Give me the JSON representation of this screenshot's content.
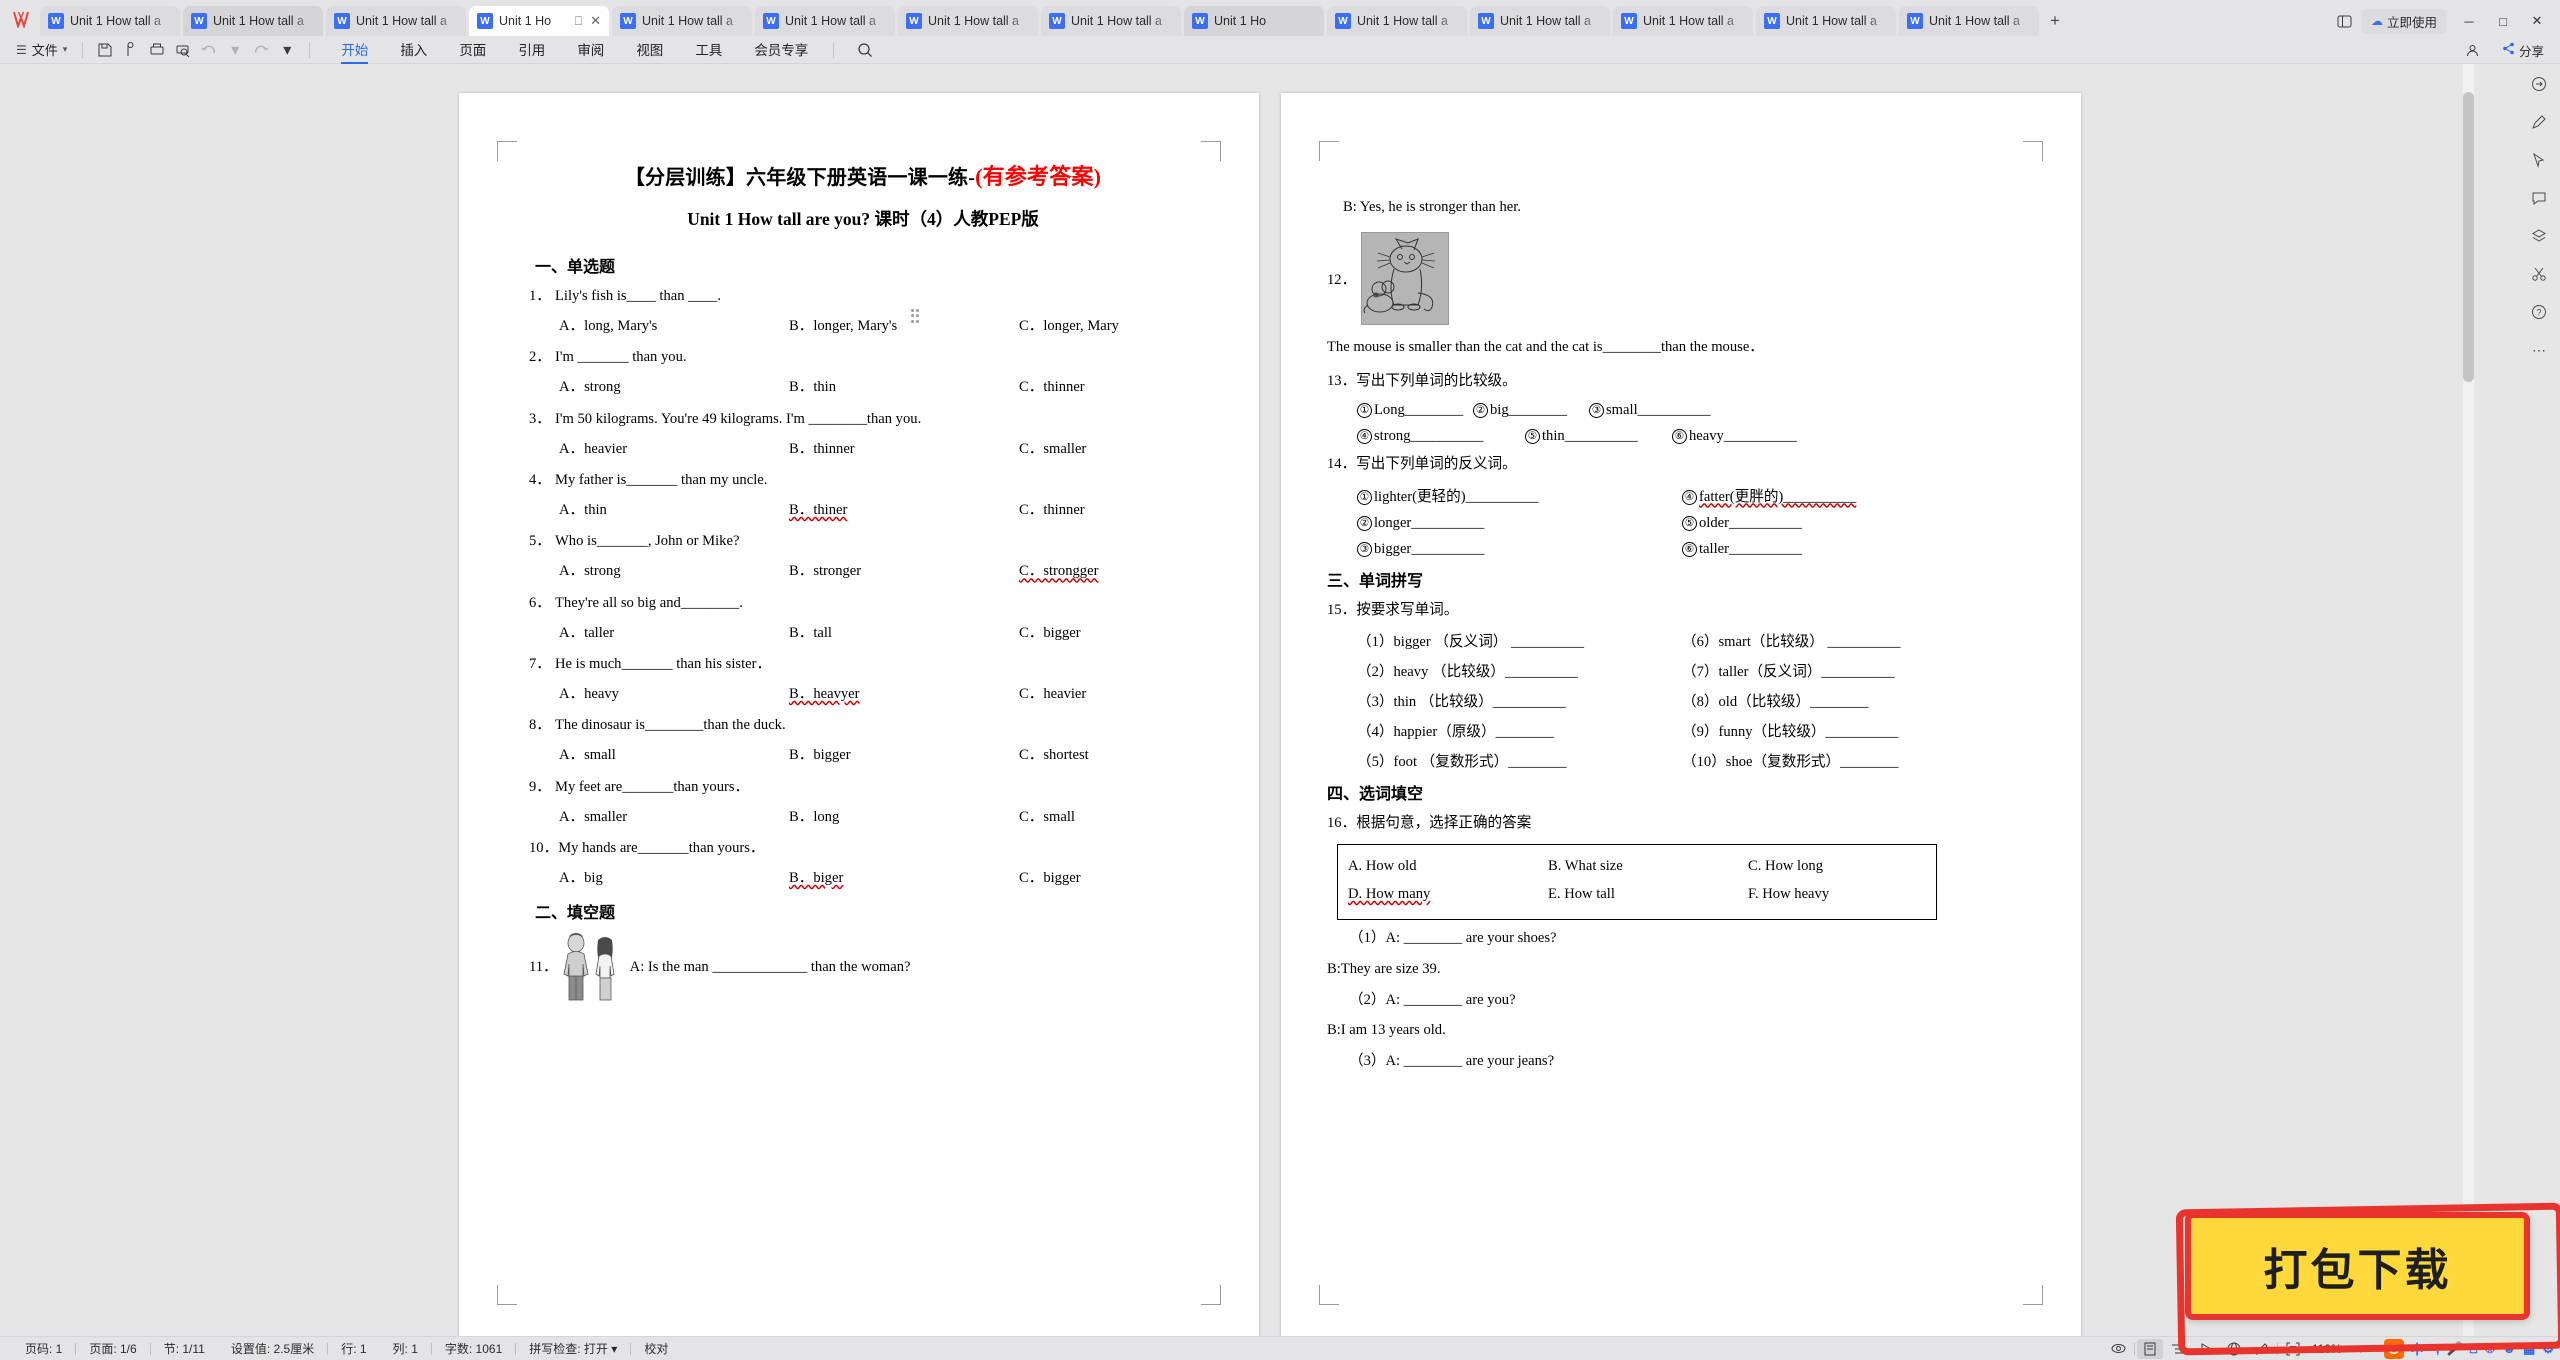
{
  "app": {
    "logo": "W",
    "tab_title": "Unit 1 How tall a",
    "tab_title_active": "Unit 1 Ho",
    "tab_count": 14,
    "new_tab_icon": "+",
    "cloud_label": "立即使用",
    "share_label": "分享",
    "window_minimize": "─",
    "window_maximize": "□",
    "window_close": "✕"
  },
  "ribbon": {
    "file_label": "文件",
    "quick_icons": [
      "save-icon",
      "cloud-save-icon",
      "print-icon",
      "print-preview-icon",
      "undo-icon",
      "undo-dropdown-icon",
      "redo-icon",
      "more-dropdown-icon"
    ],
    "menu": [
      {
        "label": "开始",
        "active": true
      },
      {
        "label": "插入",
        "active": false
      },
      {
        "label": "页面",
        "active": false
      },
      {
        "label": "引用",
        "active": false
      },
      {
        "label": "审阅",
        "active": false
      },
      {
        "label": "视图",
        "active": false
      },
      {
        "label": "工具",
        "active": false
      },
      {
        "label": "会员专享",
        "active": false
      }
    ],
    "search_icon": "search-icon"
  },
  "document": {
    "title_black": "【分层训练】六年级下册英语一课一练-",
    "title_red": "(有参考答案)",
    "subtitle": "Unit 1 How tall are you?   课时（4）人教PEP版",
    "section1": "一、单选题",
    "section2": "二、填空题",
    "section3": "三、单词拼写",
    "section4": "四、选词填空",
    "questions": [
      {
        "num": "1．",
        "text": "Lily's fish is____ than ____.",
        "options": [
          "A．long, Mary's",
          "B．longer, Mary's",
          "C．longer, Mary"
        ]
      },
      {
        "num": "2．",
        "text": "I'm _______ than you.",
        "options": [
          "A．strong",
          "B．thin",
          "C．thinner"
        ]
      },
      {
        "num": "3．",
        "text": "I'm 50 kilograms. You're 49 kilograms. I'm ________than you.",
        "options": [
          "A．heavier",
          "B．thinner",
          "C．smaller"
        ]
      },
      {
        "num": "4．",
        "text": "My father is_______ than my uncle.",
        "options": [
          "A．thin",
          "B．thiner",
          "C．thinner"
        ],
        "misspelled": 1
      },
      {
        "num": "5．",
        "text": "Who is_______, John or Mike?",
        "options": [
          "A．strong",
          "B．stronger",
          "C．strongger"
        ],
        "misspelled": 2
      },
      {
        "num": "6．",
        "text": "They're all so big and________.",
        "options": [
          "A．taller",
          "B．tall",
          "C．bigger"
        ]
      },
      {
        "num": "7．",
        "text": "He is  much_______ than his sister．",
        "options": [
          "A．heavy",
          "B．heavyer",
          "C．heavier"
        ],
        "misspelled": 1
      },
      {
        "num": "8．",
        "text": "The dinosaur is________than the duck.",
        "options": [
          "A．small",
          "B．bigger",
          "C．shortest"
        ]
      },
      {
        "num": "9．",
        "text": "My feet are_______than yours．",
        "options": [
          "A．smaller",
          "B．long",
          "C．small"
        ]
      },
      {
        "num": "10．",
        "text": "My hands are_______than yours．",
        "options": [
          "A．big",
          "B．biger",
          "C．bigger"
        ],
        "misspelled": 1
      }
    ],
    "q11": {
      "num": "11．",
      "text": "A: Is the man _____________ than the woman?",
      "image": "man-and-woman-illustration"
    },
    "q11b": "B: Yes, he is stronger than her.",
    "q12": {
      "num": "12．",
      "image": "cat-and-mouse-illustration",
      "text": "The mouse is smaller than the cat and the cat is________than the mouse．"
    },
    "q13": {
      "num": "13．",
      "text": "写出下列单词的比较级。",
      "row1": [
        {
          "c": "①",
          "w": "Long________"
        },
        {
          "c": "②",
          "w": "big________"
        },
        {
          "c": "③",
          "w": "small__________"
        }
      ],
      "row2": [
        {
          "c": "④",
          "w": "strong__________"
        },
        {
          "c": "⑤",
          "w": "thin__________"
        },
        {
          "c": "⑥",
          "w": "heavy__________"
        }
      ]
    },
    "q14": {
      "num": "14．",
      "text": "写出下列单词的反义词。",
      "left": [
        {
          "c": "①",
          "w": "lighter(更轻的)__________"
        },
        {
          "c": "②",
          "w": "longer__________"
        },
        {
          "c": "③",
          "w": "bigger__________"
        }
      ],
      "right": [
        {
          "c": "④",
          "w": "fatter(更胖的)__________",
          "misspell": true
        },
        {
          "c": "⑤",
          "w": "older__________"
        },
        {
          "c": "⑥",
          "w": "taller__________"
        }
      ]
    },
    "q15": {
      "num": "15．",
      "text": "按要求写单词。",
      "left": [
        "（1）bigger （反义词） __________",
        "（2）heavy （比较级）__________",
        "（3）thin （比较级）__________",
        "（4）happier（原级）________",
        "（5）foot （复数形式）________"
      ],
      "right": [
        "（6）smart（比较级） __________",
        "（7）taller（反义词）__________",
        "（8）old（比较级）________",
        "（9）funny（比较级）__________",
        "（10）shoe（复数形式）________"
      ]
    },
    "q16": {
      "num": "16．",
      "text": "根据句意，选择正确的答案",
      "box_row1": [
        "A. How old",
        "B. What size",
        "C. How long"
      ],
      "box_row2": [
        "D. How many",
        "E. How tall",
        "F. How  heavy"
      ],
      "box_misspell_row2": 0,
      "items": [
        "（1）A: ________ are your shoes?",
        "B:They are size 39.",
        "（2）A: ________ are you?",
        "B:I am 13 years old.",
        "（3）A: ________ are your jeans?"
      ]
    }
  },
  "statusbar": {
    "items": [
      "页码: 1",
      "页面: 1/6",
      "节: 1/11",
      "设置值: 2.5厘米",
      "行: 1",
      "列: 1",
      "字数: 1061",
      "拼写检查: 打开",
      "校对"
    ],
    "zoom": "110%",
    "view_icons": [
      "eye-icon",
      "page-view-icon",
      "outline-view-icon",
      "read-view-icon",
      "web-view-icon",
      "highlight-icon",
      "fullscreen-icon"
    ],
    "ime": [
      "sogou-logo",
      "中",
      "°,",
      "mic-icon",
      "keyboard-icon",
      "palette-icon",
      "panda-icon",
      "apps-icon",
      "settings-icon"
    ]
  },
  "rail": {
    "icons": [
      "share-arrow-icon",
      "pen-icon",
      "cursor-icon",
      "comment-icon",
      "layers-icon",
      "scissors-icon",
      "help-icon",
      "more-icon"
    ]
  },
  "stamp": {
    "label": "打包下载"
  }
}
